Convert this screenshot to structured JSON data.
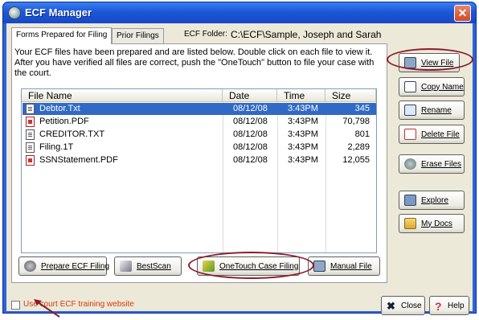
{
  "window": {
    "title": "ECF Manager",
    "close_glyph": "✕"
  },
  "tabs": [
    {
      "label": "Forms Prepared for Filing"
    },
    {
      "label": "Prior Filings"
    }
  ],
  "folder": {
    "label": "ECF Folder:",
    "path": "C:\\ECF\\Sample, Joseph and Sarah"
  },
  "instructions": "Your ECF files have been prepared and are listed below. Double click on each file to view it. After you have verified all files are correct, push the \"OneTouch\" button to file your case with the court.",
  "file_list": {
    "columns": [
      "File Name",
      "Date",
      "Time",
      "Size"
    ],
    "rows": [
      {
        "name": "Debtor.Txt",
        "date": "08/12/08",
        "time": "3:43PM",
        "size": "345",
        "icon": "text-file-icon",
        "selected": true
      },
      {
        "name": "Petition.PDF",
        "date": "08/12/08",
        "time": "3:43PM",
        "size": "70,798",
        "icon": "pdf-file-icon",
        "selected": false
      },
      {
        "name": "CREDITOR.TXT",
        "date": "08/12/08",
        "time": "3:43PM",
        "size": "801",
        "icon": "text-file-icon",
        "selected": false
      },
      {
        "name": "Filing.1T",
        "date": "08/12/08",
        "time": "3:43PM",
        "size": "2,289",
        "icon": "text-file-icon",
        "selected": false
      },
      {
        "name": "SSNStatement.PDF",
        "date": "08/12/08",
        "time": "3:43PM",
        "size": "12,055",
        "icon": "pdf-file-icon",
        "selected": false
      }
    ]
  },
  "side_buttons": {
    "view_file": "View File",
    "copy_name": "Copy Name",
    "rename": "Rename",
    "delete_file": "Delete File",
    "erase_files": "Erase Files",
    "explore": "Explore",
    "my_docs": "My Docs"
  },
  "bottom_buttons": {
    "prepare": "Prepare ECF Filing",
    "bestscan": "BestScan",
    "onetouch": "OneTouch Case Filing",
    "manual": "Manual File",
    "close": "Close",
    "help": "Help"
  },
  "training_checkbox": {
    "label": "Use court ECF training website",
    "checked": false
  },
  "colors": {
    "annotation": "#8b1a2a",
    "selection": "#316ac5",
    "warning_text": "#d63a10"
  }
}
